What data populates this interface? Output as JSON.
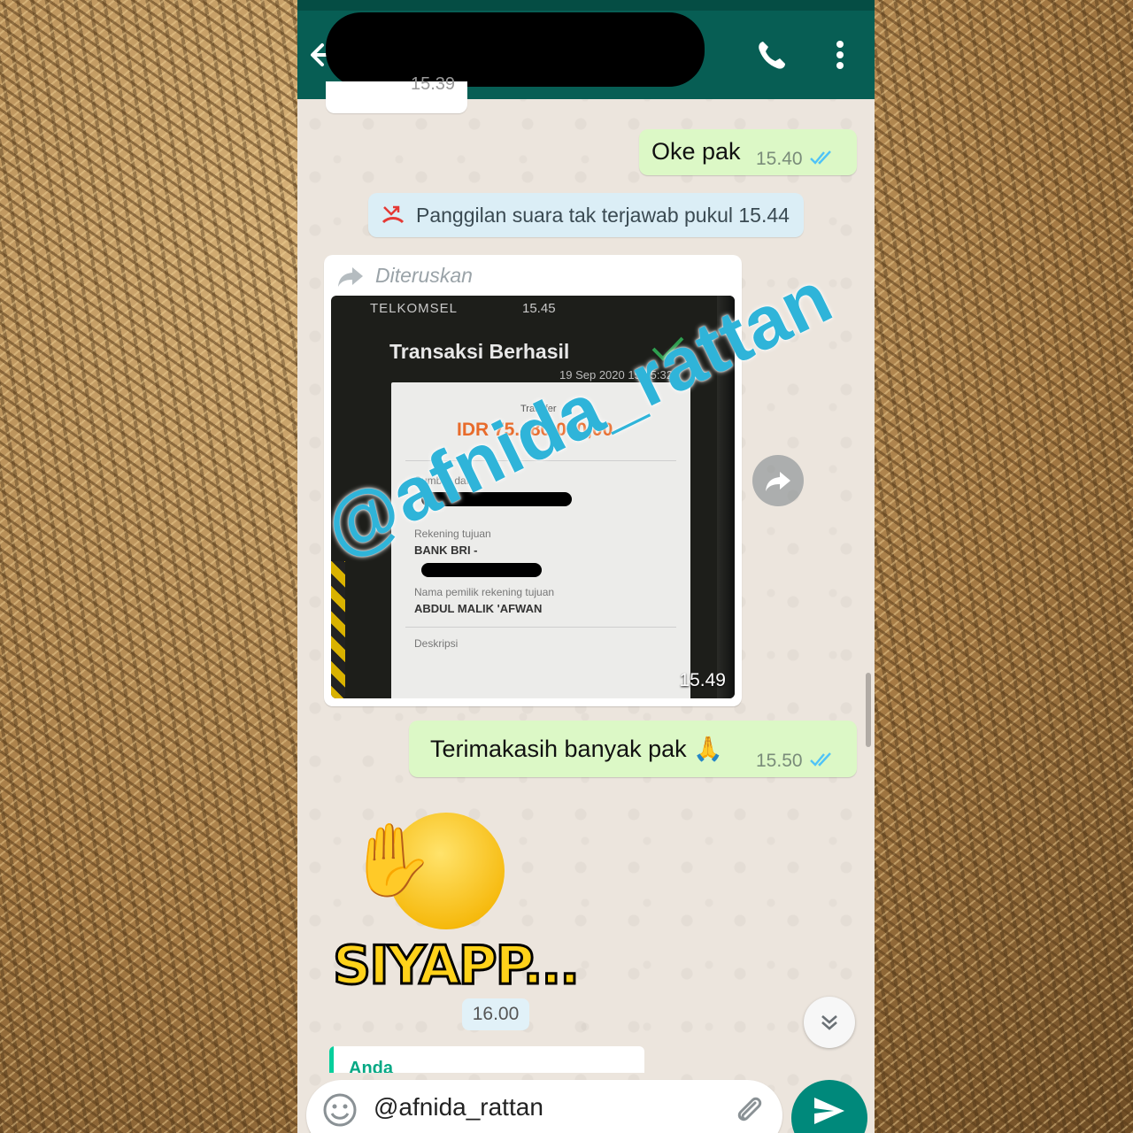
{
  "header": {
    "contact_name": ""
  },
  "messages": {
    "partial_time": "15.39",
    "oke_text": "Oke pak",
    "oke_time": "15.40",
    "missed_call_text": "Panggilan suara tak terjawab pukul 15.44",
    "forwarded_label": "Diteruskan",
    "photo_time": "15.49",
    "thanks_text": "Terimakasih banyak pak 🙏",
    "thanks_time": "15.50",
    "sticker_text": "SIYAPP...",
    "date_chip": "16.00",
    "quoted_author": "Anda"
  },
  "receipt": {
    "carrier": "TELKOMSEL",
    "clock": "15.45",
    "title": "Transaksi Berhasil",
    "datetime": "19 Sep 2020 15:45:32",
    "type_label": "Transfer",
    "amount": "IDR 75.480.000,00",
    "source_label": "Sumber dana",
    "dest_label": "Rekening tujuan",
    "dest_bank": "BANK BRI -",
    "owner_label": "Nama pemilik rekening tujuan",
    "owner_name": "ABDUL MALIK 'AFWAN",
    "desc_label": "Deskripsi"
  },
  "watermark": "@afnida_rattan",
  "composer": {
    "value": "@afnida_rattan"
  },
  "colors": {
    "header": "#075e54",
    "outgoing_bubble": "#dcf8c6",
    "send_button": "#00897b",
    "watermark": "#2fb4d9",
    "read_ticks": "#4fc3f7"
  }
}
